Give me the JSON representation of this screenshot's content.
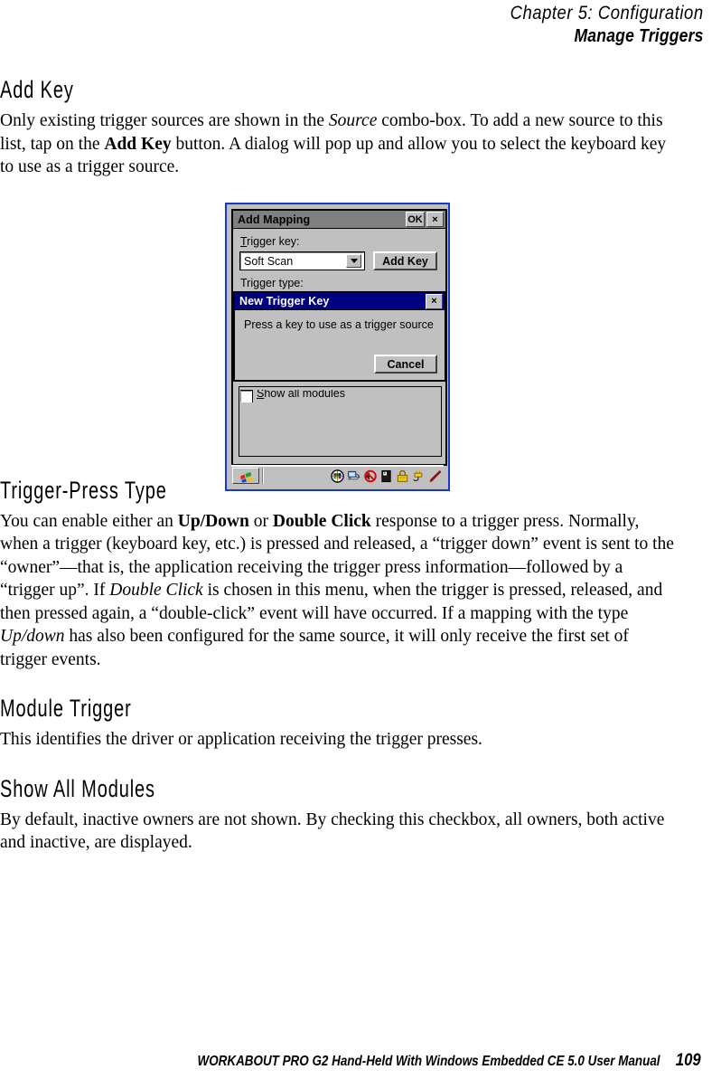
{
  "header": {
    "chapter": "Chapter 5: Configuration",
    "section": "Manage Triggers"
  },
  "sections": [
    {
      "title": "Add Key",
      "paragraph_html": "Only existing trigger sources are shown in the <i>Source</i> combo-box. To add a new source to this list, tap on the <b>Add Key</b> button. A dialog will pop up and allow you to select the keyboard key to use as a trigger source."
    },
    {
      "title": "Trigger-Press Type",
      "paragraph_html": "You can enable either an <b>Up/Down</b> or <b>Double Click</b> response to a trigger press. Normally, when a trigger (keyboard key, etc.) is pressed and released, a &ldquo;trigger down&rdquo; event is sent to the &ldquo;owner&rdquo;&mdash;that is, the application receiving the trigger press information&mdash;followed by a &ldquo;trigger up&rdquo;. If <i>Double Click</i> is chosen in this menu, when the trigger is pressed, released, and then pressed again, a &ldquo;double-click&rdquo; event will have occurred. If a mapping with the type <i>Up/down</i> has also been configured for the same source, it will only receive the first set of trigger events."
    },
    {
      "title": "Module Trigger",
      "paragraph_html": "This identifies the driver or application receiving the trigger presses."
    },
    {
      "title": "Show All Modules",
      "paragraph_html": "By default, inactive owners are not shown. By checking this checkbox, all owners, both active and inactive, are displayed."
    }
  ],
  "device": {
    "add_mapping_dialog": {
      "title": "Add Mapping",
      "ok_button": "OK",
      "close_button": "×",
      "trigger_key_label_accel": "T",
      "trigger_key_label_rest": "rigger key:",
      "combo_value": "Soft Scan",
      "add_key_button": "Add Key",
      "obscured_label": "Trigger type:",
      "show_all_modules_accel": "S",
      "show_all_modules_rest": "how all modules"
    },
    "new_trigger_key_dialog": {
      "title": "New Trigger Key",
      "close_button": "×",
      "message": "Press a key to use as a trigger source",
      "cancel_button": "Cancel"
    },
    "taskbar": {
      "start_icon": "windows-start-icon",
      "tray_icons": [
        "display-settings-icon",
        "network-connection-icon",
        "volume-muted-icon",
        "power-battery-icon",
        "lock-icon",
        "ac-adapter-icon",
        "stylus-icon"
      ]
    },
    "colors": {
      "screen_border": "#1b39c8",
      "window_face": "#c0c0c0",
      "inactive_titlebar": "#808080",
      "active_titlebar": "#000080"
    }
  },
  "footer": {
    "manual_title": "WORKABOUT PRO G2 Hand-Held With Windows Embedded CE 5.0 User Manual",
    "page_number": "109"
  }
}
